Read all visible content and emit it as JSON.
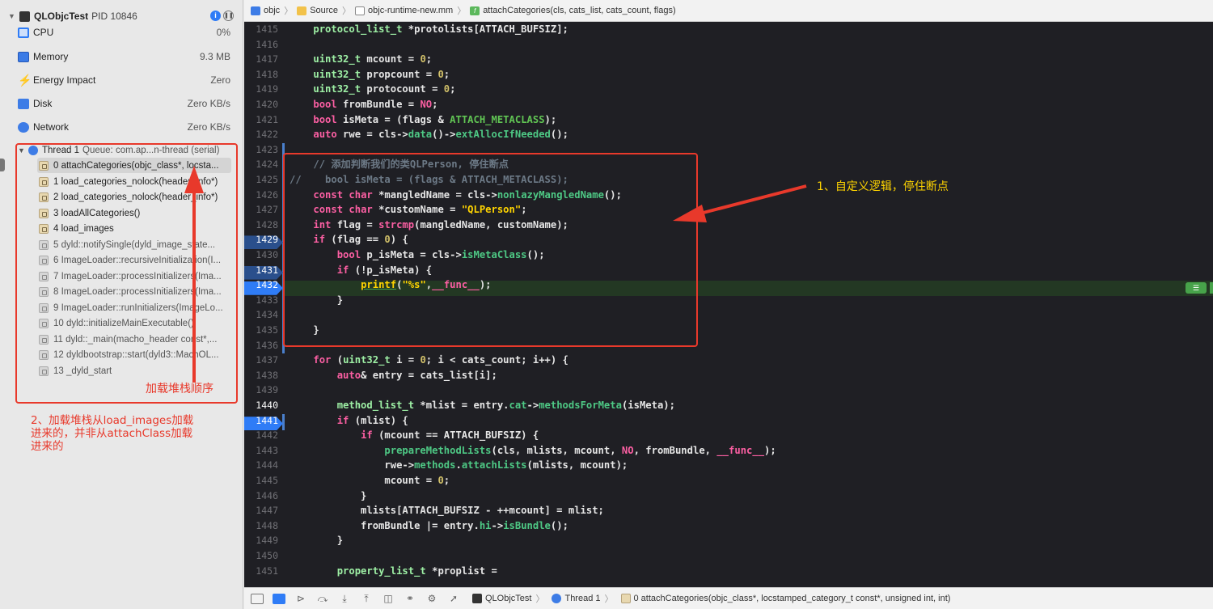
{
  "navigator": {
    "process_name": "QLObjcTest",
    "pid": "PID 10846",
    "gauges": [
      {
        "name": "CPU",
        "value": "0%"
      },
      {
        "name": "Memory",
        "value": "9.3 MB"
      },
      {
        "name": "Energy Impact",
        "value": "Zero"
      },
      {
        "name": "Disk",
        "value": "Zero KB/s"
      },
      {
        "name": "Network",
        "value": "Zero KB/s"
      }
    ],
    "thread": {
      "label": "Thread 1",
      "queue": "Queue: com.ap...n-thread (serial)"
    },
    "frames": [
      "0 attachCategories(objc_class*, locsta...",
      "1 load_categories_nolock(header_info*)",
      "2 load_categories_nolock(header_info*)",
      "3 loadAllCategories()",
      "4 load_images",
      "5 dyld::notifySingle(dyld_image_state...",
      "6 ImageLoader::recursiveInitialization(I...",
      "7 ImageLoader::processInitializers(Ima...",
      "8 ImageLoader::processInitializers(Ima...",
      "9 ImageLoader::runInitializers(ImageLo...",
      "10 dyld::initializeMainExecutable()",
      "11 dyld::_main(macho_header const*,...",
      "12 dyldbootstrap::start(dyld3::MachOL...",
      "13 _dyld_start"
    ]
  },
  "annotations": {
    "stack_label": "加载堆栈顺序",
    "note_left": "2、加载堆栈从load_images加载\n进来的，并非从attachClass加载\n进来的",
    "note_right": "1、自定义逻辑，停住断点"
  },
  "jumpbar": [
    "objc",
    "Source",
    "objc-runtime-new.mm",
    "attachCategories(cls, cats_list, cats_count, flags)"
  ],
  "code_lines": [
    {
      "n": "1415",
      "t": "    protocol_list_t *protolists[ATTACH_BUFSIZ];"
    },
    {
      "n": "1416",
      "t": ""
    },
    {
      "n": "1417",
      "t": "    uint32_t mcount = 0;"
    },
    {
      "n": "1418",
      "t": "    uint32_t propcount = 0;"
    },
    {
      "n": "1419",
      "t": "    uint32_t protocount = 0;"
    },
    {
      "n": "1420",
      "t": "    bool fromBundle = NO;"
    },
    {
      "n": "1421",
      "t": "    bool isMeta = (flags & ATTACH_METACLASS);"
    },
    {
      "n": "1422",
      "t": "    auto rwe = cls->data()->extAllocIfNeeded();"
    },
    {
      "n": "1423",
      "t": ""
    },
    {
      "n": "1424",
      "t": "    // 添加判断我们的类QLPerson, 停住断点"
    },
    {
      "n": "1425",
      "t": "//    bool isMeta = (flags & ATTACH_METACLASS);"
    },
    {
      "n": "1426",
      "t": "    const char *mangledName = cls->nonlazyMangledName();"
    },
    {
      "n": "1427",
      "t": "    const char *customName = \"QLPerson\";"
    },
    {
      "n": "1428",
      "t": "    int flag = strcmp(mangledName, customName);"
    },
    {
      "n": "1429",
      "t": "    if (flag == 0) {"
    },
    {
      "n": "1430",
      "t": "        bool p_isMeta = cls->isMetaClass();"
    },
    {
      "n": "1431",
      "t": "        if (!p_isMeta) {"
    },
    {
      "n": "1432",
      "t": "            printf(\"%s\",__func__);"
    },
    {
      "n": "1433",
      "t": "        }"
    },
    {
      "n": "1434",
      "t": ""
    },
    {
      "n": "1435",
      "t": "    }"
    },
    {
      "n": "1436",
      "t": ""
    },
    {
      "n": "1437",
      "t": "    for (uint32_t i = 0; i < cats_count; i++) {"
    },
    {
      "n": "1438",
      "t": "        auto& entry = cats_list[i];"
    },
    {
      "n": "1439",
      "t": ""
    },
    {
      "n": "1440",
      "t": "        method_list_t *mlist = entry.cat->methodsForMeta(isMeta);"
    },
    {
      "n": "1441",
      "t": "        if (mlist) {"
    },
    {
      "n": "1442",
      "t": "            if (mcount == ATTACH_BUFSIZ) {"
    },
    {
      "n": "1443",
      "t": "                prepareMethodLists(cls, mlists, mcount, NO, fromBundle, __func__);"
    },
    {
      "n": "1444",
      "t": "                rwe->methods.attachLists(mlists, mcount);"
    },
    {
      "n": "1445",
      "t": "                mcount = 0;"
    },
    {
      "n": "1446",
      "t": "            }"
    },
    {
      "n": "1447",
      "t": "            mlists[ATTACH_BUFSIZ - ++mcount] = mlist;"
    },
    {
      "n": "1448",
      "t": "            fromBundle |= entry.hi->isBundle();"
    },
    {
      "n": "1449",
      "t": "        }"
    },
    {
      "n": "1450",
      "t": ""
    },
    {
      "n": "1451",
      "t": "        property_list_t *proplist ="
    }
  ],
  "debugbar": {
    "app": "QLObjcTest",
    "thread": "Thread 1",
    "frame": "0 attachCategories(objc_class*, locstamped_category_t const*, unsigned int, int)"
  }
}
